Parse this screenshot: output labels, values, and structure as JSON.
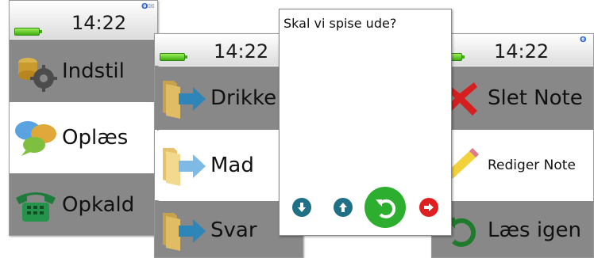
{
  "screen1": {
    "time": "14:22",
    "menu": [
      {
        "label": "Indstil",
        "icon": "gear-coins-icon"
      },
      {
        "label": "Oplæs",
        "icon": "speech-bubbles-icon"
      },
      {
        "label": "Opkald",
        "icon": "telephone-icon"
      }
    ]
  },
  "screen2": {
    "time": "14:22",
    "menu": [
      {
        "label": "Drikke",
        "icon": "folder-arrow-icon"
      },
      {
        "label": "Mad",
        "icon": "folder-arrow-icon"
      },
      {
        "label": "Svar",
        "icon": "folder-arrow-icon"
      }
    ]
  },
  "dialog": {
    "question": "Skal vi spise ude?",
    "buttons": [
      "arrow-down-icon",
      "arrow-up-icon",
      "undo-icon",
      "arrow-right-icon"
    ]
  },
  "screen4": {
    "time": "14:22",
    "menu": [
      {
        "label": "Slet Note",
        "icon": "red-x-icon"
      },
      {
        "label": "Rediger Note",
        "icon": "pencil-icon"
      },
      {
        "label": "Læs igen",
        "icon": "undo-icon"
      }
    ]
  },
  "colors": {
    "selected_row": "#ffffff",
    "row": "#888888",
    "battery": "#3fae12",
    "confirm": "#2eae2e",
    "cancel": "#e02020",
    "nav": "#1f6f86"
  }
}
